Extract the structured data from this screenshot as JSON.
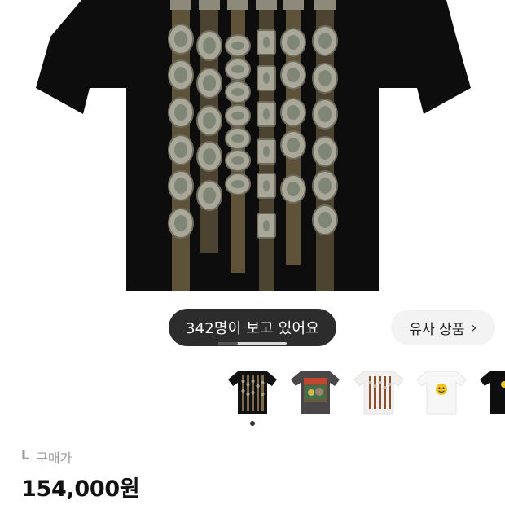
{
  "product": {
    "viewer_text": "342명이 보고 있어요",
    "similar_label": "유사 상품",
    "similar_chevron": "›",
    "size": "L",
    "purchase_label": "구매가",
    "price": "154,000원"
  },
  "icons": {
    "chevron": "chevron-right-icon"
  },
  "colors": {
    "shirt": "#0d0d0d",
    "pill_bg": "#2c2c2c",
    "button_bg": "#f3f3f3"
  }
}
